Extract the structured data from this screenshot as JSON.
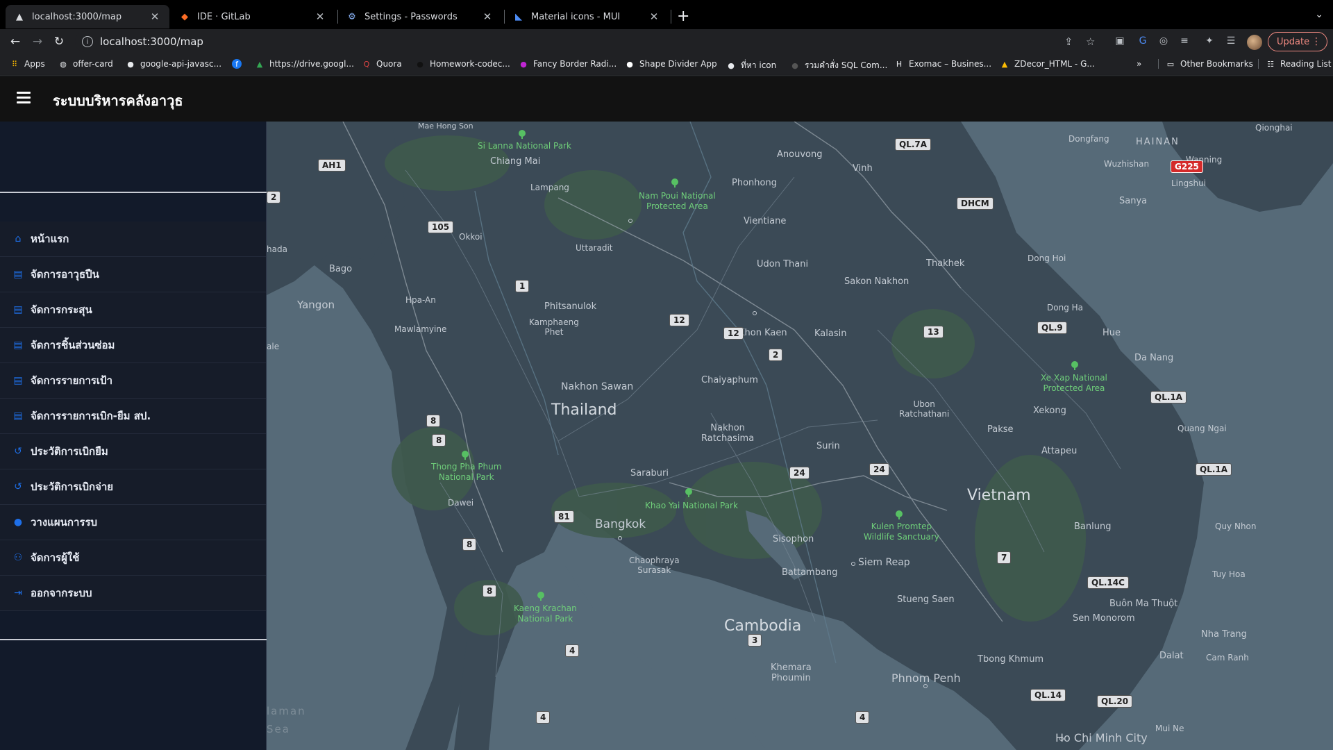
{
  "browser": {
    "tabs": [
      {
        "label": "localhost:3000/map",
        "favicon": "react-triangle-icon"
      },
      {
        "label": "IDE · GitLab",
        "favicon": "gitlab-icon"
      },
      {
        "label": "Settings - Passwords",
        "favicon": "settings-gear-icon"
      },
      {
        "label": "Material icons - MUI",
        "favicon": "mui-icon"
      }
    ],
    "close_glyph": "✕",
    "new_tab_glyph": "+",
    "url": "localhost:3000/map",
    "update_label": "Update",
    "bookmarks": [
      {
        "label": "Apps",
        "icon": "apps-grid-icon"
      },
      {
        "label": "offer-card",
        "icon": "globe-icon"
      },
      {
        "label": "google-api-javasc...",
        "icon": "github-icon"
      },
      {
        "label": "",
        "icon": "facebook-icon"
      },
      {
        "label": "https://drive.googl...",
        "icon": "google-drive-icon"
      },
      {
        "label": "Quora",
        "icon": "quora-icon"
      },
      {
        "label": "Homework-codec...",
        "icon": "codec-icon"
      },
      {
        "label": "Fancy Border Radi...",
        "icon": "fancy-border-icon"
      },
      {
        "label": "Shape Divider App",
        "icon": "shape-divider-icon"
      },
      {
        "label": "ที่หา icon",
        "icon": "github-icon"
      },
      {
        "label": "รวมคำสั่ง SQL Com...",
        "icon": "sql-icon"
      },
      {
        "label": "Exomac – Busines...",
        "icon": "exomac-icon"
      },
      {
        "label": "ZDecor_HTML - G...",
        "icon": "google-drive-icon"
      }
    ],
    "more_bookmarks_glyph": "»",
    "other_bookmarks": "Other Bookmarks",
    "reading_list": "Reading List"
  },
  "app": {
    "title": "ระบบบริหารคลังอาวุธ",
    "menu": [
      {
        "label": "หน้าแรก",
        "icon": "home-icon"
      },
      {
        "label": "จัดการอาวุธปืน",
        "icon": "clipboard-icon"
      },
      {
        "label": "จัดการกระสุน",
        "icon": "clipboard-icon"
      },
      {
        "label": "จัดการชิ้นส่วนซ่อม",
        "icon": "clipboard-icon"
      },
      {
        "label": "จัดการรายการเป้า",
        "icon": "clipboard-icon"
      },
      {
        "label": "จัดการรายการเบิก-ยืม สป.",
        "icon": "clipboard-icon"
      },
      {
        "label": "ประวัติการเบิกยืม",
        "icon": "history-icon"
      },
      {
        "label": "ประวัติการเบิกจ่าย",
        "icon": "history-icon"
      },
      {
        "label": "วางแผนการรบ",
        "icon": "location-pin-icon"
      },
      {
        "label": "จัดการผู้ใช้",
        "icon": "manage-users-icon"
      },
      {
        "label": "ออกจากระบบ",
        "icon": "logout-icon"
      }
    ]
  },
  "map": {
    "countries": {
      "thailand": "Thailand",
      "cambodia": "Cambodia",
      "vietnam": "Vietnam",
      "hainan": "HAINAN"
    },
    "cities": {
      "mae_hong_son": "Mae Hong Son",
      "chiang_mai": "Chiang Mai",
      "lampang": "Lampang",
      "anouvong": "Anouvong",
      "phonhong": "Phonhong",
      "vientiane": "Vientiane",
      "vinh": "Vinh",
      "dongfang": "Dongfang",
      "wuzhishan": "Wuzhishan",
      "wanning": "Wanning",
      "lingshui": "Lingshui",
      "sanya": "Sanya",
      "qionghai": "Qionghai",
      "bago": "Bago",
      "yangon": "Yangon",
      "okkoi": "Okkoi",
      "uttaradit": "Uttaradit",
      "udon_thani": "Udon Thani",
      "thakhek": "Thakhek",
      "sakon_nakhon": "Sakon Nakhon",
      "dong_hoi": "Dong Hoi",
      "dong_ha": "Dong Ha",
      "hua_an": "Hpa-An",
      "mawlamyine": "Mawlamyine",
      "phitsanulok": "Phitsanulok",
      "kamphaeng_phet": "Kamphaeng\nPhet",
      "khon_kaen": "Khon Kaen",
      "kalasin": "Kalasin",
      "hue": "Hue",
      "da_nang": "Da Nang",
      "chaiyaphum": "Chaiyaphum",
      "nakhon_sawan": "Nakhon Sawan",
      "xekong": "Xekong",
      "ubon": "Ubon\nRatchathani",
      "nakhon_ratchasima": "Nakhon\nRatchasima",
      "surin": "Surin",
      "pakse": "Pakse",
      "quang_ngai": "Quang Ngai",
      "attapeu": "Attapeu",
      "saraburi": "Saraburi",
      "bangkok": "Bangkok",
      "dawei": "Dawei",
      "banlung": "Banlung",
      "quy_nhon": "Quy Nhon",
      "sisophon": "Sisophon",
      "siem_reap": "Siem Reap",
      "chaophraya": "Chaophraya\nSurasak",
      "battambang": "Battambang",
      "tuy_hoa": "Tuy Hoa",
      "buon_ma_thuot": "Buôn Ma Thuột",
      "stueng_saen": "Stueng Saen",
      "sen_monorom": "Sen Monorom",
      "nha_trang": "Nha Trang",
      "dalat": "Dalat",
      "cam_ranh": "Cam Ranh",
      "thong_khmum": "Tbong Khmum",
      "khemara": "Khemara\nPhoumin",
      "phnom_penh": "Phnom Penh",
      "hcmc": "Ho Chi Minh City",
      "mui_ne": "Mui Ne"
    },
    "parks": {
      "si_lanna": "Si Lanna National Park",
      "nam_poui": "Nam Poui National\nProtected Area",
      "xe_xap": "Xe Xap National\nProtected Area",
      "thong_pha_phum": "Thong Pha Phum\nNational Park",
      "khao_yai": "Khao Yai National Park",
      "kulen": "Kulen Promtep\nWildlife Sanctuary",
      "kaeng_krachan": "Kaeng Krachan\nNational Park"
    },
    "seas": {
      "andaman_1": "laman",
      "andaman_2": "Sea"
    },
    "edge_labels": {
      "hada": "hada",
      "ale": "ale"
    },
    "road_shields": {
      "ah1": "AH1",
      "r2a": "2",
      "r105": "105",
      "r1": "1",
      "r12a": "12",
      "r12b": "12",
      "r2b": "2",
      "ql7a": "QL.7A",
      "dhcm": "DHCM",
      "g225": "G225",
      "ql9": "QL.9",
      "r13": "13",
      "ql1a_a": "QL.1A",
      "ql1a_b": "QL.1A",
      "r8a": "8",
      "r8b": "8",
      "r24a": "24",
      "r24b": "24",
      "r81": "81",
      "r8c": "8",
      "r8d": "8",
      "r7": "7",
      "ql14c": "QL.14C",
      "r4a": "4",
      "r3": "3",
      "r4b": "4",
      "r4c": "4",
      "ql14": "QL.14",
      "ql20": "QL.20"
    },
    "colors": {
      "land": "#3b4a56",
      "water": "#566a78",
      "park": "#57c063",
      "border": "#9aa4ad"
    }
  }
}
